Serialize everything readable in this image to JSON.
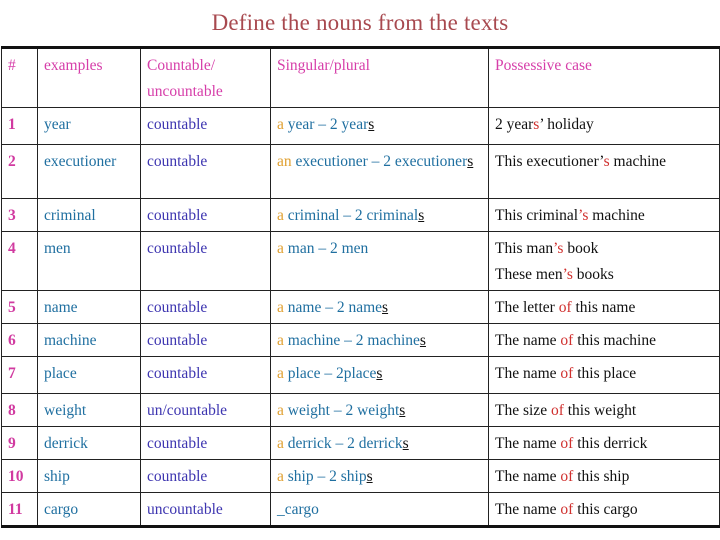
{
  "title": "Define the nouns  from the texts",
  "colors": {
    "title": "#a8494f",
    "header": "#d63ea9",
    "row_number": "#d13aa0",
    "example": "#1f6fa0",
    "countability": "#3d35b0",
    "article": "#e0a030",
    "possessive_marker": "#d0302e"
  },
  "table": {
    "headers": [
      "#",
      "examples",
      "Countable/ uncountable",
      "Singular/plural",
      "Possessive case"
    ],
    "rows": [
      {
        "num": "1",
        "example": "year",
        "countability": "countable",
        "sp": {
          "article": "a",
          "body": " year – 2 year",
          "suffix": "s",
          "tail": ""
        },
        "pos": [
          {
            "pre": "2 year",
            "mark": "s",
            "post": "’ holiday"
          }
        ]
      },
      {
        "num": "2",
        "example": "executioner",
        "countability": "countable",
        "sp": {
          "article": "an",
          "body": " executioner – 2 executioner",
          "suffix": "s",
          "tail": ""
        },
        "pos": [
          {
            "pre": "This executioner’",
            "mark": "s",
            "post": " machine"
          }
        ]
      },
      {
        "num": "3",
        "example": "criminal",
        "countability": "countable",
        "sp": {
          "article": "a",
          "body": " criminal – 2 criminal",
          "suffix": "s",
          "tail": ""
        },
        "pos": [
          {
            "pre": "This criminal",
            "mark": "’s",
            "post": " machine"
          }
        ]
      },
      {
        "num": "4",
        "example": "men",
        "countability": "countable",
        "sp": {
          "article": "a",
          "body": " man – 2 men",
          "suffix": "",
          "tail": ""
        },
        "pos": [
          {
            "pre": "This man",
            "mark": "’s",
            "post": " book"
          },
          {
            "pre": "These men",
            "mark": "’s",
            "post": " books"
          }
        ]
      },
      {
        "num": "5",
        "example": "name",
        "countability": "countable",
        "sp": {
          "article": "a",
          "body": " name – 2 name",
          "suffix": "s",
          "tail": ""
        },
        "pos": [
          {
            "pre": "The letter ",
            "mark": "of",
            "post": " this name"
          }
        ]
      },
      {
        "num": "6",
        "example": "machine",
        "countability": "countable",
        "sp": {
          "article": "a",
          "body": " machine – 2 machine",
          "suffix": "s",
          "tail": ""
        },
        "pos": [
          {
            "pre": "The name ",
            "mark": "of",
            "post": " this machine"
          }
        ]
      },
      {
        "num": "7",
        "example": "place",
        "countability": "countable",
        "sp": {
          "article": "a",
          "body": " place – 2place",
          "suffix": "s",
          "tail": ""
        },
        "pos": [
          {
            "pre": "The name ",
            "mark": "of",
            "post": " this place"
          }
        ]
      },
      {
        "num": "8",
        "example": "weight",
        "countability": "un/countable",
        "sp": {
          "article": "a",
          "body": " weight – 2 weight",
          "suffix": "s",
          "tail": ""
        },
        "pos": [
          {
            "pre": "The size ",
            "mark": "of",
            "post": " this weight"
          }
        ]
      },
      {
        "num": "9",
        "example": "derrick",
        "countability": "countable",
        "sp": {
          "article": "a",
          "body": " derrick – 2 derrick",
          "suffix": "s",
          "tail": ""
        },
        "pos": [
          {
            "pre": "The name ",
            "mark": "of",
            "post": " this derrick"
          }
        ]
      },
      {
        "num": "10",
        "example": "ship",
        "countability": "countable",
        "sp": {
          "article": "a",
          "body": " ship – 2 ship",
          "suffix": "s",
          "tail": ""
        },
        "pos": [
          {
            "pre": "The name ",
            "mark": "of",
            "post": " this ship"
          }
        ]
      },
      {
        "num": "11",
        "example": "cargo",
        "countability": "uncountable",
        "sp": {
          "article": "",
          "body": "_cargo",
          "suffix": "",
          "tail": ""
        },
        "pos": [
          {
            "pre": "The name ",
            "mark": "of",
            "post": " this cargo"
          }
        ]
      }
    ]
  }
}
